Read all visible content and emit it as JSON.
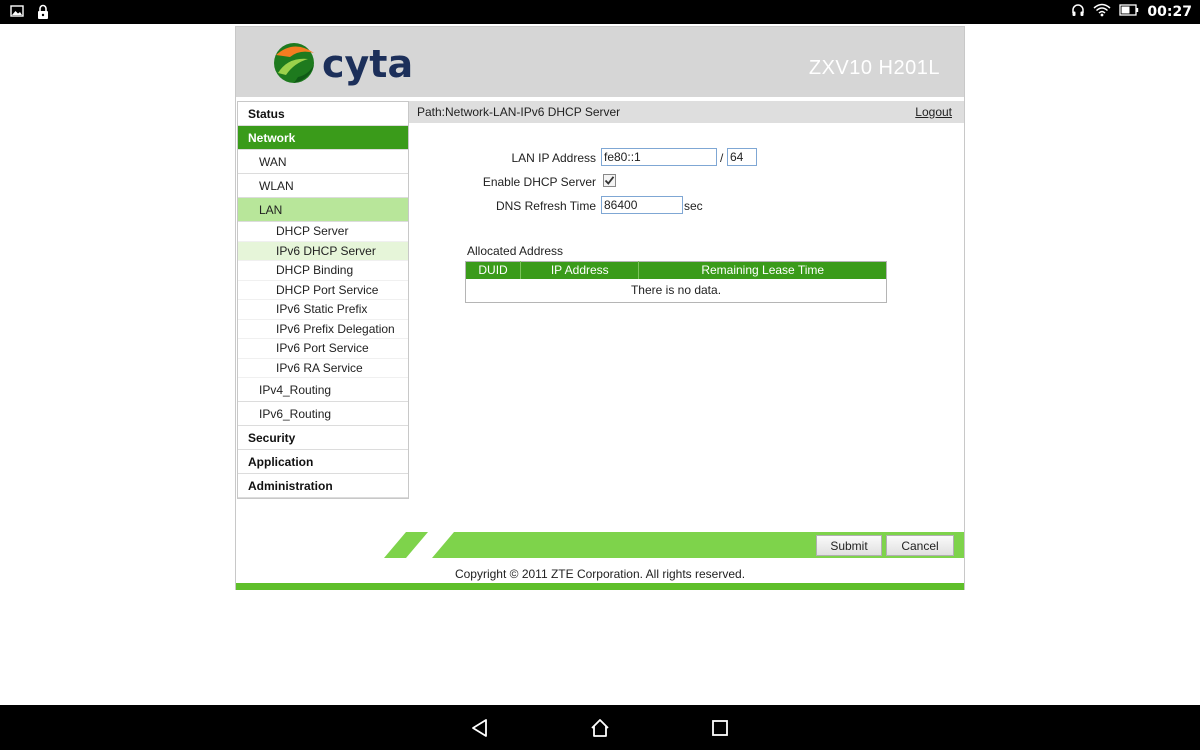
{
  "status_bar": {
    "time": "00:27",
    "left_icons": [
      "image-icon",
      "lock-icon"
    ],
    "right_icons": [
      "headphones-icon",
      "wifi-icon",
      "battery-icon"
    ]
  },
  "router": {
    "logo_text": "cyta",
    "model": "ZXV10 H201L",
    "path": "Path:Network-LAN-IPv6 DHCP Server",
    "logout": "Logout"
  },
  "sidebar": {
    "items": [
      {
        "label": "Status",
        "level": "top"
      },
      {
        "label": "Network",
        "level": "top",
        "active": true
      },
      {
        "label": "WAN",
        "level": "sub"
      },
      {
        "label": "WLAN",
        "level": "sub"
      },
      {
        "label": "LAN",
        "level": "sub",
        "active": true
      },
      {
        "label": "DHCP Server",
        "level": "leaf"
      },
      {
        "label": "IPv6 DHCP Server",
        "level": "leaf",
        "active": true
      },
      {
        "label": "DHCP Binding",
        "level": "leaf"
      },
      {
        "label": "DHCP Port Service",
        "level": "leaf"
      },
      {
        "label": "IPv6 Static Prefix",
        "level": "leaf"
      },
      {
        "label": "IPv6 Prefix Delegation",
        "level": "leaf"
      },
      {
        "label": "IPv6 Port Service",
        "level": "leaf"
      },
      {
        "label": "IPv6 RA Service",
        "level": "leaf"
      },
      {
        "label": "IPv4_Routing",
        "level": "sub"
      },
      {
        "label": "IPv6_Routing",
        "level": "sub"
      },
      {
        "label": "Security",
        "level": "top"
      },
      {
        "label": "Application",
        "level": "top"
      },
      {
        "label": "Administration",
        "level": "top"
      }
    ]
  },
  "form": {
    "lan_ip_label": "LAN IP Address",
    "lan_ip_value": "fe80::1",
    "prefix_separator": "/",
    "prefix_value": "64",
    "enable_dhcp_label": "Enable DHCP Server",
    "enable_dhcp_checked": true,
    "dns_refresh_label": "DNS Refresh Time",
    "dns_refresh_value": "86400",
    "dns_refresh_unit": "sec"
  },
  "allocated": {
    "caption": "Allocated Address",
    "columns": [
      "DUID",
      "IP Address",
      "Remaining Lease Time"
    ],
    "empty_text": "There is no data."
  },
  "footer": {
    "submit": "Submit",
    "cancel": "Cancel",
    "copyright": "Copyright © 2011 ZTE Corporation. All rights reserved."
  },
  "colors": {
    "accent_green": "#3a9b1a",
    "light_green": "#7ed34b",
    "banner_gray": "#d6d6d6"
  }
}
